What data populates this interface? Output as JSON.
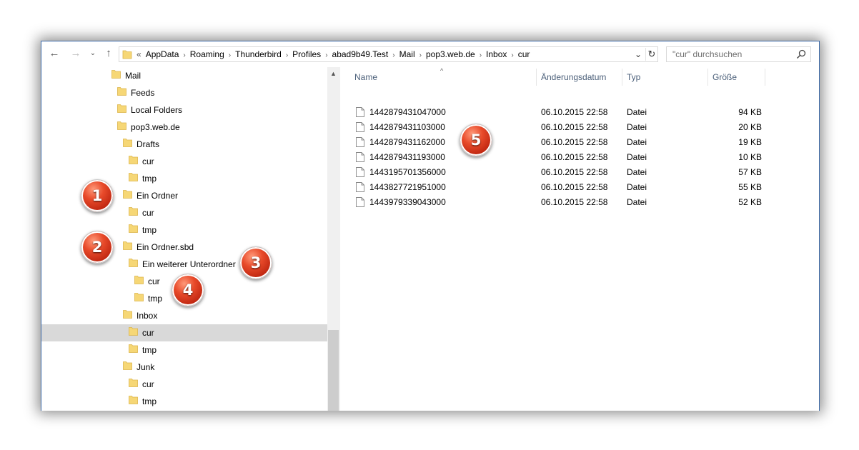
{
  "address": {
    "lead": "«",
    "crumbs": [
      "AppData",
      "Roaming",
      "Thunderbird",
      "Profiles",
      "abad9b49.Test",
      "Mail",
      "pop3.web.de",
      "Inbox",
      "cur"
    ]
  },
  "search": {
    "placeholder": "\"cur\" durchsuchen"
  },
  "tree": [
    {
      "label": "Mail"
    },
    {
      "label": "Feeds"
    },
    {
      "label": "Local Folders"
    },
    {
      "label": "pop3.web.de"
    },
    {
      "label": "Drafts"
    },
    {
      "label": "cur"
    },
    {
      "label": "tmp"
    },
    {
      "label": "Ein Ordner"
    },
    {
      "label": "cur"
    },
    {
      "label": "tmp"
    },
    {
      "label": "Ein Ordner.sbd"
    },
    {
      "label": "Ein weiterer Unterordner"
    },
    {
      "label": "cur"
    },
    {
      "label": "tmp"
    },
    {
      "label": "Inbox"
    },
    {
      "label": "cur",
      "selected": true
    },
    {
      "label": "tmp"
    },
    {
      "label": "Junk"
    },
    {
      "label": "cur"
    },
    {
      "label": "tmp"
    }
  ],
  "columns": {
    "name": "Name",
    "date": "Änderungsdatum",
    "type": "Typ",
    "size": "Größe"
  },
  "files": [
    {
      "name": "1442879431047000",
      "date": "06.10.2015 22:58",
      "type": "Datei",
      "size": "94 KB"
    },
    {
      "name": "1442879431103000",
      "date": "06.10.2015 22:58",
      "type": "Datei",
      "size": "20 KB"
    },
    {
      "name": "1442879431162000",
      "date": "06.10.2015 22:58",
      "type": "Datei",
      "size": "19 KB"
    },
    {
      "name": "1442879431193000",
      "date": "06.10.2015 22:58",
      "type": "Datei",
      "size": "10 KB"
    },
    {
      "name": "1443195701356000",
      "date": "06.10.2015 22:58",
      "type": "Datei",
      "size": "57 KB"
    },
    {
      "name": "1443827721951000",
      "date": "06.10.2015 22:58",
      "type": "Datei",
      "size": "55 KB"
    },
    {
      "name": "1443979339043000",
      "date": "06.10.2015 22:58",
      "type": "Datei",
      "size": "52 KB"
    }
  ],
  "badges": [
    "1",
    "2",
    "3",
    "4",
    "5"
  ],
  "colors": {
    "badge": "#d8391b",
    "folder": "#f6d776",
    "selection": "#d9d9d9"
  }
}
